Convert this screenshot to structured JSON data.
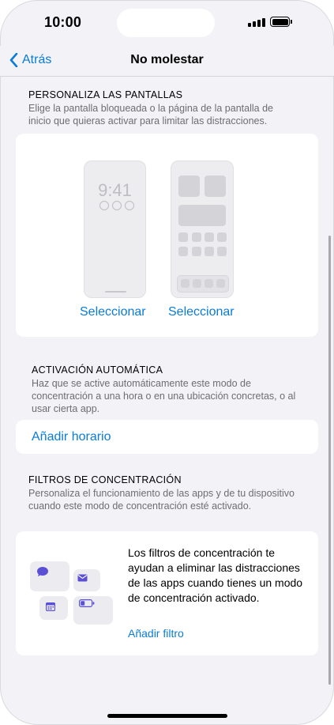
{
  "status_bar": {
    "time": "10:00"
  },
  "nav": {
    "back_label": "Atrás",
    "title": "No molestar"
  },
  "screens_section": {
    "header": "PERSONALIZA LAS PANTALLAS",
    "description": "Elige la pantalla bloqueada o la página de la pantalla de inicio que quieras activar para limitar las distracciones.",
    "lock_preview_time": "9:41",
    "select_lock_label": "Seleccionar",
    "select_home_label": "Seleccionar"
  },
  "automation_section": {
    "header": "ACTIVACIÓN AUTOMÁTICA",
    "description": "Haz que se active automáticamente este modo de concentración a una hora o en una ubicación concretas, o al usar cierta app.",
    "add_schedule_label": "Añadir horario"
  },
  "filters_section": {
    "header": "FILTROS DE CONCENTRACIÓN",
    "description": "Personaliza el funcionamiento de las apps y de tu dispositivo cuando este modo de concentración esté activado.",
    "card_text": "Los filtros de concentración te ayudan a eliminar las distracciones de las apps cuando tienes un modo de concentración activado.",
    "add_filter_label": "Añadir filtro"
  },
  "colors": {
    "accent": "#0a7cd6",
    "icon_purple": "#5b4fd6",
    "background": "#f2f2f7"
  },
  "icons": [
    "chevron-left-icon",
    "chat-bubble-icon",
    "envelope-icon",
    "calendar-icon",
    "battery-icon",
    "signal-icon"
  ]
}
